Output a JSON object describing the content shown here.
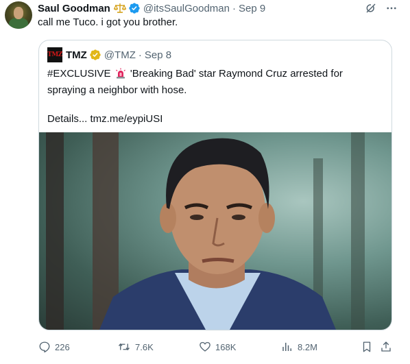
{
  "tweet": {
    "author_name": "Saul Goodman",
    "author_handle": "@itsSaulGoodman",
    "separator": "·",
    "date": "Sep 9",
    "text": "call me Tuco. i got you brother."
  },
  "quoted_tweet": {
    "author_name": "TMZ",
    "avatar_text": "TMZ",
    "author_handle": "@TMZ",
    "separator": "·",
    "date": "Sep 8",
    "text_part1": "#EXCLUSIVE",
    "text_part2": "'Breaking Bad' star Raymond Cruz arrested for spraying a neighbor with hose.",
    "details_text": "Details... tmz.me/eypiUSI"
  },
  "actions": {
    "replies": "226",
    "reposts": "7.6K",
    "likes": "168K",
    "views": "8.2M"
  },
  "icons": {
    "grok": "grok-icon",
    "more": "more-icon",
    "reply": "reply-icon",
    "repost": "repost-icon",
    "like": "like-icon",
    "views": "views-icon",
    "bookmark": "bookmark-icon",
    "share": "share-icon"
  },
  "colors": {
    "text_primary": "#0f1419",
    "text_secondary": "#536471",
    "verified_blue": "#1d9bf0",
    "verified_gold": "#e2b719",
    "border": "#cfd9de"
  }
}
